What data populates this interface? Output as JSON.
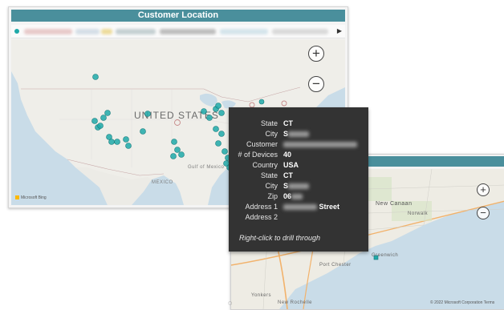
{
  "main_card": {
    "title": "Customer Location",
    "map_labels": {
      "country": "UNITED STATES",
      "gulf": "Gulf of Mexico",
      "mexico": "MEXICO",
      "bing": "Microsoft Bing"
    }
  },
  "zoom": {
    "in": "+",
    "out": "−"
  },
  "tooltip": {
    "rows": [
      {
        "label": "State",
        "value": "CT"
      },
      {
        "label": "City",
        "value": "S"
      },
      {
        "label": "Customer",
        "value": ""
      },
      {
        "label": "# of Devices",
        "value": "40"
      },
      {
        "label": "Country",
        "value": "USA"
      },
      {
        "label": "State",
        "value": "CT"
      },
      {
        "label": "City",
        "value": "S"
      },
      {
        "label": "Zip",
        "value": "06"
      },
      {
        "label": "Address 1",
        "value": "Street"
      },
      {
        "label": "Address 2",
        "value": ""
      }
    ],
    "hint": "Right-click to drill through"
  },
  "detail_card": {
    "title": "ner Location",
    "map_labels": {
      "new_canaan": "New Canaan",
      "norwalk": "Norwalk",
      "greenwich": "Greenwich",
      "port_chester": "Port Chester",
      "yonkers": "Yonkers",
      "new_rochelle": "New Rochelle",
      "copyright": "© 2022 Microsoft Corporation  Terms"
    }
  },
  "colors": {
    "header": "#4a8f9c",
    "marker": "#1fa9a9",
    "tooltip_bg": "#333333"
  }
}
